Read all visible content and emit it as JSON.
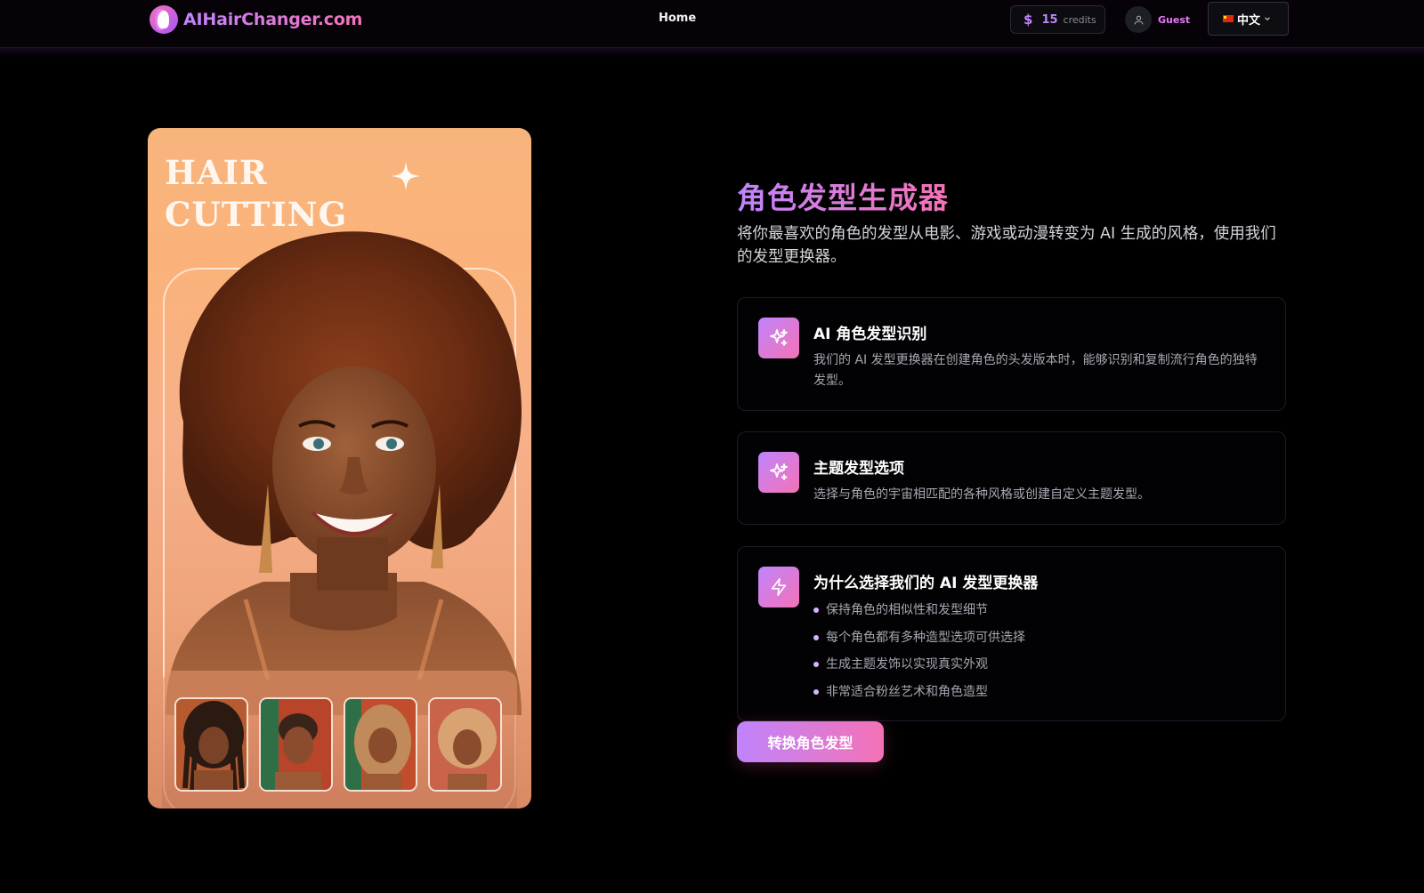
{
  "header": {
    "logo_text": "AIHairChanger.com",
    "nav_home": "Home",
    "credits_symbol": "$",
    "credits_count": "15",
    "credits_label": "credits",
    "user_label": "Guest",
    "language": "中文"
  },
  "hero_image": {
    "title_line1": "HAIR",
    "title_line2": "CUTTING"
  },
  "main": {
    "heading": "角色发型生成器",
    "lead": "将你最喜欢的角色的发型从电影、游戏或动漫转变为 AI 生成的风格，使用我们的发型更换器。",
    "features": [
      {
        "icon": "sparkles-icon",
        "title": "AI 角色发型识别",
        "desc": "我们的 AI 发型更换器在创建角色的头发版本时，能够识别和复制流行角色的独特发型。"
      },
      {
        "icon": "sparkles-icon",
        "title": "主题发型选项",
        "desc": "选择与角色的宇宙相匹配的各种风格或创建自定义主题发型。"
      },
      {
        "icon": "lightning-icon",
        "title": "为什么选择我们的 AI 发型更换器",
        "bullets": [
          "保持角色的相似性和发型细节",
          "每个角色都有多种造型选项可供选择",
          "生成主题发饰以实现真实外观",
          "非常适合粉丝艺术和角色造型"
        ]
      }
    ],
    "cta_label": "转换角色发型"
  },
  "colors": {
    "accent_start": "#c084fc",
    "accent_end": "#f472b6",
    "background": "#000000"
  }
}
